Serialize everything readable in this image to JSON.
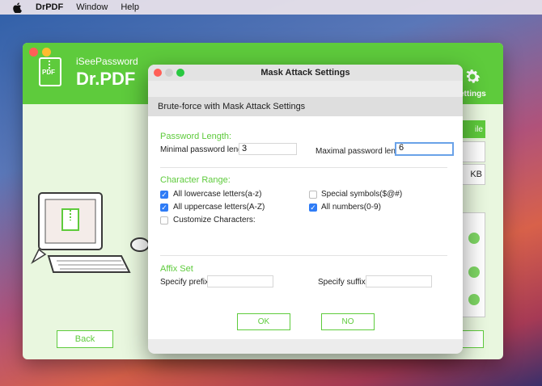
{
  "menubar": {
    "app_name": "DrPDF",
    "items": [
      "Window",
      "Help"
    ]
  },
  "app": {
    "brand_small": "iSeePassword",
    "brand_large": "Dr.PDF",
    "logo_text": "PDF",
    "settings_label": "ettings",
    "back_label": "Back",
    "partial_file_label": "ile",
    "partial_size_label": "KB",
    "accent_color": "#5ecb3c"
  },
  "dialog": {
    "title": "Mask Attack Settings",
    "subtitle": "Brute-force with Mask Attack Settings",
    "password_length": {
      "heading": "Password Length:",
      "min_label": "Minimal password length:",
      "min_value": "3",
      "max_label": "Maximal password length:",
      "max_value": "6"
    },
    "character_range": {
      "heading": "Character Range:",
      "options": [
        {
          "label": "All lowercase letters(a-z)",
          "checked": true
        },
        {
          "label": "All uppercase letters(A-Z)",
          "checked": true
        },
        {
          "label": "Customize Characters:",
          "checked": false
        },
        {
          "label": "Special symbols($@#)",
          "checked": false
        },
        {
          "label": "All numbers(0-9)",
          "checked": true
        }
      ]
    },
    "affix": {
      "heading": "Affix Set",
      "prefix_label": "Specify prefix:",
      "prefix_value": "",
      "suffix_label": "Specify suffix:",
      "suffix_value": ""
    },
    "ok_label": "OK",
    "no_label": "NO"
  }
}
